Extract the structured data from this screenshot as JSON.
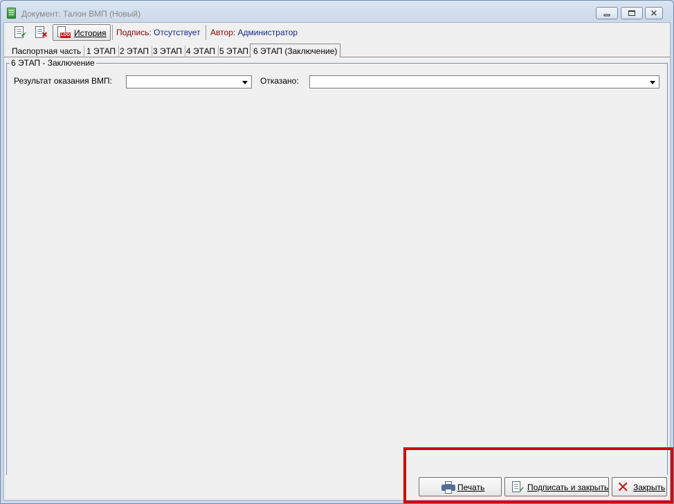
{
  "window": {
    "title": "Документ: Талон ВМП (Новый)",
    "controls": {
      "minimize": "minimize",
      "maximize": "maximize",
      "close": "✕"
    }
  },
  "toolbar": {
    "sign_icon": "document-check-icon",
    "unsign_icon": "document-cross-icon",
    "history": {
      "label": "История",
      "icon_tag": "LOG"
    },
    "signature_label": "Подпись:",
    "signature_value": "Отсутствует",
    "author_label": "Автор:",
    "author_value": "Администратор"
  },
  "tabs": [
    {
      "label": "Паспортная часть",
      "active": false
    },
    {
      "label": "1 ЭТАП",
      "active": false
    },
    {
      "label": "2 ЭТАП",
      "active": false
    },
    {
      "label": "3 ЭТАП",
      "active": false
    },
    {
      "label": "4 ЭТАП",
      "active": false
    },
    {
      "label": "5 ЭТАП",
      "active": false
    },
    {
      "label": "6 ЭТАП (Заключение)",
      "active": true
    }
  ],
  "group": {
    "title": "6 ЭТАП - Заключение",
    "result_label": "Результат оказания ВМП:",
    "result_value": "",
    "refused_label": "Отказано:",
    "refused_value": ""
  },
  "buttons": {
    "print": "Печать",
    "sign_close": "Подписать и закрыть",
    "close": "Закрыть"
  },
  "colors": {
    "highlight": "#d40000",
    "label_red": "#8b0000",
    "value_blue": "#1a2a8a"
  }
}
